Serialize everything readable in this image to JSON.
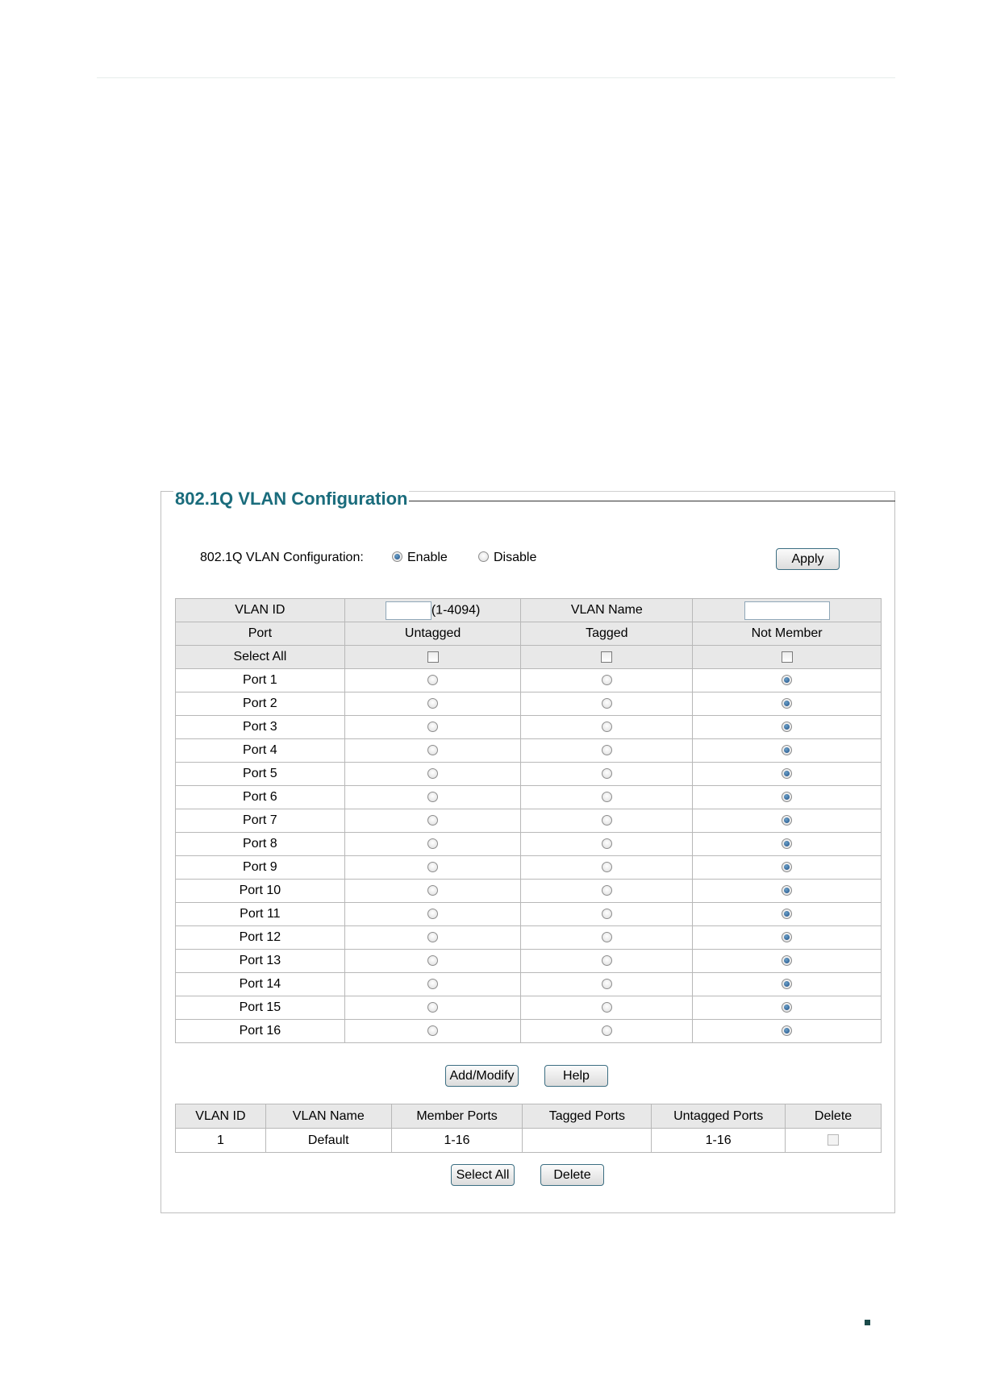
{
  "panel": {
    "title": "802.1Q VLAN Configuration",
    "config_label": "802.1Q VLAN Configuration:",
    "enable_label": "Enable",
    "disable_label": "Disable",
    "selected_mode": "Enable",
    "apply_label": "Apply"
  },
  "vlan_form": {
    "vlan_id_label": "VLAN ID",
    "vlan_id_value": "",
    "vlan_id_range": "(1-4094)",
    "vlan_name_label": "VLAN Name",
    "vlan_name_value": "",
    "columns": [
      "Port",
      "Untagged",
      "Tagged",
      "Not Member"
    ],
    "select_all_label": "Select All",
    "ports": [
      {
        "name": "Port 1",
        "selected": "Not Member"
      },
      {
        "name": "Port 2",
        "selected": "Not Member"
      },
      {
        "name": "Port 3",
        "selected": "Not Member"
      },
      {
        "name": "Port 4",
        "selected": "Not Member"
      },
      {
        "name": "Port 5",
        "selected": "Not Member"
      },
      {
        "name": "Port 6",
        "selected": "Not Member"
      },
      {
        "name": "Port 7",
        "selected": "Not Member"
      },
      {
        "name": "Port 8",
        "selected": "Not Member"
      },
      {
        "name": "Port 9",
        "selected": "Not Member"
      },
      {
        "name": "Port 10",
        "selected": "Not Member"
      },
      {
        "name": "Port 11",
        "selected": "Not Member"
      },
      {
        "name": "Port 12",
        "selected": "Not Member"
      },
      {
        "name": "Port 13",
        "selected": "Not Member"
      },
      {
        "name": "Port 14",
        "selected": "Not Member"
      },
      {
        "name": "Port 15",
        "selected": "Not Member"
      },
      {
        "name": "Port 16",
        "selected": "Not Member"
      }
    ],
    "add_modify_label": "Add/Modify",
    "help_label": "Help"
  },
  "vlan_table": {
    "columns": [
      "VLAN ID",
      "VLAN Name",
      "Member Ports",
      "Tagged Ports",
      "Untagged Ports",
      "Delete"
    ],
    "rows": [
      {
        "vlan_id": "1",
        "vlan_name": "Default",
        "member_ports": "1-16",
        "tagged_ports": "",
        "untagged_ports": "1-16",
        "delete_checked": false,
        "delete_disabled": true
      }
    ],
    "select_all_label": "Select All",
    "delete_label": "Delete"
  },
  "colors": {
    "title": "#1a6c7c",
    "header_bg": "#e8e8e8",
    "radio_selected": "#1f4f86"
  }
}
